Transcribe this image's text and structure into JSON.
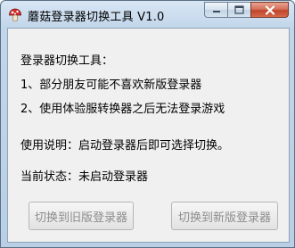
{
  "window": {
    "title": "蘑菇登录器切换工具 V1.0",
    "app_icon": "mushroom-icon"
  },
  "caption_buttons": {
    "minimize_icon": "minimize-icon",
    "maximize_icon": "maximize-icon",
    "close_icon": "close-icon"
  },
  "content": {
    "heading": "登录器切换工具：",
    "item1": "1、部分朋友可能不喜欢新版登录器",
    "item2": "2、使用体验服转换器之后无法登录游戏",
    "usage": "使用说明：启动登录器后即可选择切换。",
    "status": "当前状态：未启动登录器"
  },
  "buttons": {
    "switch_old_label": "切换到旧版登录器",
    "switch_new_label": "切换到新版登录器",
    "enabled": false
  },
  "colors": {
    "accent_red": "#d32f2f",
    "disabled_text": "#8d8d8d"
  }
}
